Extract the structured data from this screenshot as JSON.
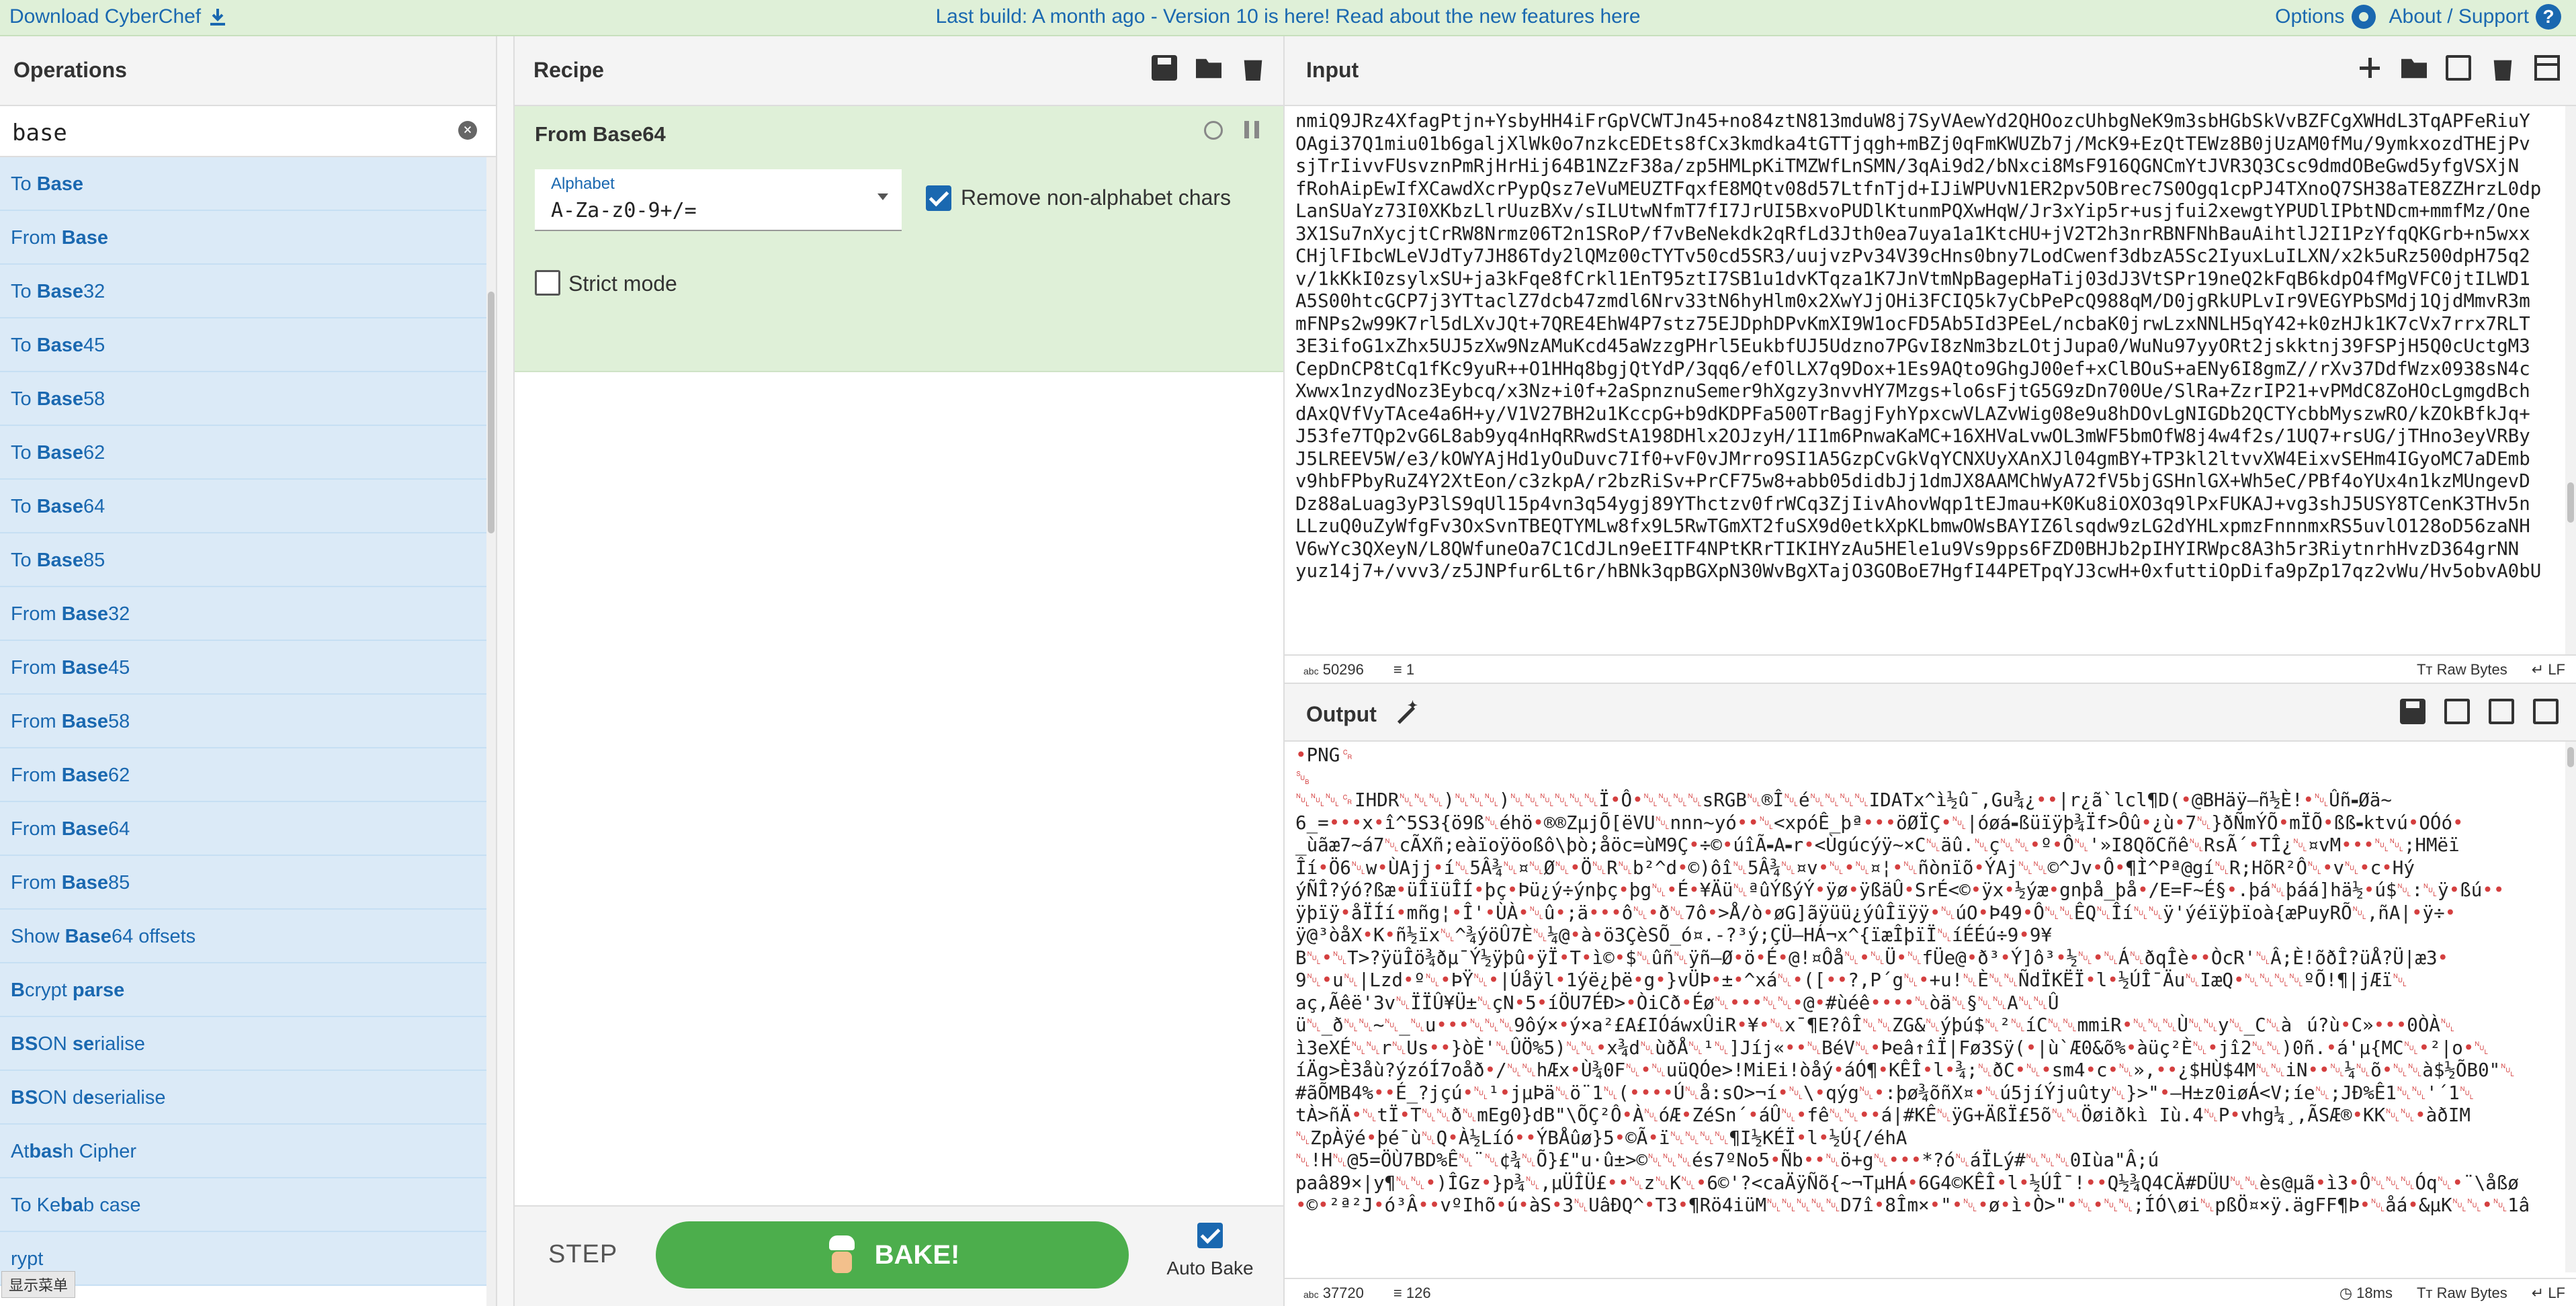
{
  "topbar": {
    "download_label": "Download CyberChef",
    "announcement": "Last build: A month ago - Version 10 is here! Read about the new features here",
    "options_label": "Options",
    "about_label": "About / Support",
    "help_glyph": "?"
  },
  "operations": {
    "title": "Operations",
    "search_value": "base",
    "items": [
      {
        "pre": "To ",
        "match": "Base",
        "post": ""
      },
      {
        "pre": "From ",
        "match": "Base",
        "post": ""
      },
      {
        "pre": "To ",
        "match": "Base",
        "post": "32"
      },
      {
        "pre": "To ",
        "match": "Base",
        "post": "45"
      },
      {
        "pre": "To ",
        "match": "Base",
        "post": "58"
      },
      {
        "pre": "To ",
        "match": "Base",
        "post": "62"
      },
      {
        "pre": "To ",
        "match": "Base",
        "post": "64"
      },
      {
        "pre": "To ",
        "match": "Base",
        "post": "85"
      },
      {
        "pre": "From ",
        "match": "Base",
        "post": "32"
      },
      {
        "pre": "From ",
        "match": "Base",
        "post": "45"
      },
      {
        "pre": "From ",
        "match": "Base",
        "post": "58"
      },
      {
        "pre": "From ",
        "match": "Base",
        "post": "62"
      },
      {
        "pre": "From ",
        "match": "Base",
        "post": "64"
      },
      {
        "pre": "From ",
        "match": "Base",
        "post": "85"
      },
      {
        "pre": "Show ",
        "match": "Base",
        "post": "64 offsets"
      },
      {
        "pre": "",
        "match": "B",
        "post": "crypt ",
        "match2": "parse"
      },
      {
        "pre": "",
        "match": "BS",
        "post": "ON ",
        "match2": "se",
        "post2": "rialise"
      },
      {
        "pre": "",
        "match": "BS",
        "post": "ON d",
        "match2": "e",
        "post2": "serialise"
      },
      {
        "pre": "At",
        "match": "bas",
        "post": "h Cipher"
      },
      {
        "pre": "To Ke",
        "match": "ba",
        "post": "b case"
      },
      {
        "pre": "",
        "match": "",
        "post": "rypt"
      }
    ],
    "overlay_badge": "显示菜单"
  },
  "recipe": {
    "title": "Recipe",
    "operation_title": "From Base64",
    "alphabet_label": "Alphabet",
    "alphabet_value": "A-Za-z0-9+/=",
    "remove_label": "Remove non-alphabet chars",
    "remove_checked": true,
    "strict_label": "Strict mode",
    "strict_checked": false,
    "step_label": "STEP",
    "bake_label": "BAKE!",
    "auto_bake_label": "Auto Bake",
    "auto_bake_checked": true
  },
  "input": {
    "title": "Input",
    "lines": [
      "nmiQ9JRz4XfagPtjn+YsbyHH4iFrGpVCWTJn45+no84ztN813mduW8j7SyVAewYd2QHOozcUhbgNeK9m3sbHGbSkVvBZFCgXWHdL3TqAPFeRiuY",
      "OAgi37Q1miu01b6galjXlWk0o7nzkcEDEts8fCx3kmdka4tGTTjqgh+mBZj0qFmKWUZb7j/McK9+EzQtTEWz8B0jUzAM0fMu/9ymkxozdTHEjPv",
      "sjTrIivvFUsvznPmRjHrHij64B1NZzF38a/zp5HMLpKiTMZWfLnSMN/3qAi9d2/bNxci8MsF916QGNCmYtJVR3Q3Csc9dmdOBeGwd5yfgVSXjN",
      "fRohAipEwIfXCawdXcrPypQsz7eVuMEUZTFqxfE8MQtv08d57LtfnTjd+IJiWPUvN1ER2pv5OBrec7S0Ogq1cpPJ4TXnoQ7SH38aTE8ZZHrzL0dp",
      "LanSUaYz73I0XKbzLlrUuzBXv/sILUtwNfmT7fI7JrUI5BxvoPUDlKtunmPQXwHqW/Jr3xYip5r+usjfui2xewgtYPUDlIPbtNDcm+mmfMz/One",
      "3X1Su7nXycjtCrRW8Nrmz06T2n1SRoP/f7vBeNekdk2qRfLd3Jth0ea7uya1a1KtcHU+jV2T2h3nrRBNFNhBauAihtlJ2I1PzYfqQKGrb+n5wxx",
      "CHjlFIbcWLeVJdTy7JH86Tdy2lQMz00cTYTv50cd5SR3/uujvzPv34V39cHns0bny7LodCwenf3dbzA5Sc2IyuxLuILXN/x2k5uRz500dpH75q2",
      "v/1kKkI0zsylxSU+ja3kFqe8fCrkl1EnT95ztI7SB1u1dvKTqza1K7JnVtmNpBagepHaTij03dJ3VtSPr19neQ2kFqB6kdpO4fMgVFC0jtILWD1",
      "A5S00htcGCP7j3YTtaclZ7dcb47zmdl6Nrv33tN6hyHlm0x2XwYJjOHi3FCIQ5k7yCbPePcQ988qM/D0jgRkUPLvIr9VEGYPbSMdj1QjdMmvR3m",
      "mFNPs2w99K7rl5dLXvJQt+7QRE4EhW4P7stz75EJDphDPvKmXI9W1ocFD5Ab5Id3PEeL/ncbaK0jrwLzxNNLH5qY42+k0zHJk1K7cVx7rrx7RLT",
      "3E3ifoG1xZhx5UJ5zXw9NzAMuKcd45aWzzgPHrl5EukbfUJ5Udzno7PGvI8zNm3bzLOtjJupa0/WuNu97yyORt2jskktnj39FSPjH5Q0cUctgM3",
      "CepDnCP8tCq1fKc9yuR++O1HHq8bgjQtYdP/3qq6/efOlLX7q9Dox+1Es9AQto9GhgJ00ef+xClBOuS+aENy6I8gmZ//rXv37DdfWzx0938sN4c",
      "Xwwx1nzydNoz3Eybcq/x3Nz+i0f+2aSpnznuSemer9hXgzy3nvvHY7Mzgs+lo6sFjtG5G9zDn700Ue/SlRa+ZzrIP21+vPMdC8ZoHOcLgmgdBch",
      "dAxQVfVyTAce4a6H+y/V1V27BH2u1KccpG+b9dKDPFa500TrBagjFyhYpxcwVLAZvWig08e9u8hDOvLgNIGDb2QCTYcbbMyszwRO/kZOkBfkJq+",
      "J53fe7TQp2vG6L8ab9yq4nHqRRwdStA198DHlx2OJzyH/1I1m6PnwaKaMC+16XHVaLvwOL3mWF5bmOfW8j4w4f2s/1UQ7+rsUG/jTHno3eyVRBy",
      "J5LREEV5W/e3/kOWYAjHd1yOuDuvc7If0+vF0vJMrro9SI1A5GzpCvGkVqYCNXUyXAnXJl04gmBY+TP3kl2ltvvXW4EixvSEHm4IGyoMC7aDEmb",
      "v9hbFPbyRuZ4Y2XtEon/c3zkpA/r2bzRiSv+PrCF75w8+abb05didbJj1dmJX8AAMChWyA72fV5bjGSHnlGX+Wh5eC/PBf4oYUx4n1kzMUngevD",
      "Dz88aLuag3yP3lS9qUl15p4vn3q54ygj89YThctzv0frWCq3ZjIivAhovWqp1tEJmau+K0Ku8iOXO3q9lPxFUKAJ+vg3shJ5USY8TCenK3THv5n",
      "LLzuQ0uZyWfgFv3OxSvnTBEQTYMLw8fx9L5RwTGmXT2fuSX9d0etkXpKLbmwOWsBAYIZ6lsqdw9zLG2dYHLxpmzFnnnmxRS5uvlO128oD56zaNH",
      "V6wYc3QXeyN/L8QWfuneOa7C1CdJLn9eEITF4NPtKRrTIKIHYzAu5HEle1u9Vs9pps6FZD0BHJb2pIHYIRWpc8A3h5r3RiytnrhHvzD364grNN",
      "yuz14j7+/vvv3/z5JNPfur6Lt6r/hBNk3qpBGXpN30WvBgXTajO3GOBoE7HgfI44PETpqYJ3cwH+0xfuttiOpDifa9pZp17qz2vWu/Hv5obvA0bU"
    ],
    "char_count": "50296",
    "line_count": "1",
    "raw_bytes_label": "Raw Bytes",
    "eol_label": "LF"
  },
  "output": {
    "title": "Output",
    "lines": [
      "•PNG␍",
      "␚",
      "␀␀␀␍IHDR␀␀␀)␀␀␀)␀␀␀␀␀␀Ï•Ô•␀␀␀␀sRGB␀®Î␀é␀␀␀␀IDATx^ì½û¯,Gu¾¿••|r¿ã`lcl¶D(•@BHäÿ–ñ½È!•␀Ûñ⁃Øä~",
      "6_=•••x•î^5S3{ö9ß␀éhö•®®ZµjÕ[ëVU␀nnn~yó••␀<xpóÊ_þª•••öØÏÇ•␀|óøá⁃ßüïÿþ¾Ïf>Ôû•¿ù•7␀}ðÑmÝÕ•mÏÕ•ßß⁃ktvú•OÓó•",
      "_ùãæ7~á7␀cÃXñ;eàïoÿöoßô\\þò;åöc=ùM9Ç•÷©•úîÃ⁃A⁃r•<Ùgúcýÿ~×C␀äû.␀ç␀␀•º•Ô␀'»I8QõCñê␀RsÃ´•TÎ¿␀¤vM•••␀␀;HMëï",
      "Îí•Ö6␀w•ÙAjj•í␀5Â¾␀¤␀Ø␀•Ö␀R␀b²^d•©)ôî␀5Â¾␀¤v•␀•␀¤¦•␀ñònïõ•ÝAj␀␀©^Jv•Ô•¶Ì^Pª@gí␀R;HõR²Ô␀•v␀•c•Hý",
      "ýÑÎ?ýó?ßæ•üÎïüÎÍ•þç•Þü¿ý÷ýnþç•þg␀•É•¥Äü␀ªûÝßýÝ•ÿø•ÿßäÛ•SrÉ<©•ÿx•½ýæ•gnþå_þå•/E=F~É§•.þá␀þáá]hä½•ú$␀:␀ÿ•ßú••",
      "ÿþïÿ•åÏÍí•mñg¦•Î'•ÙÀ•␀û•;ä•••ô␀•ð␀7ô•>Å/ò•øG]ãÿüü¿ýûÎïÿÿ•␀úO•Þ49•Ô␀␀ÊQ␀Îí␀␀ÿ'ýéïÿþïoà{æPuyRÕ␀,ñA|•ÿ÷•",
      "ÿ@³òåX•K•ñ½ïx␀^¾ýöÛ7È␀¼@•à•ö3ÇèSÕ_ó¤.-?³ý;ÇÜ–HÁ¬x^{ïæÎþïÏ␀íÉÉú÷9•9¥",
      "B␀•␀T>?ÿüÎö¾ðµ¯Ý½ÿþû•ÿÏ•T•ì©•$␀ûñ␀ÿñ–Ø•ö•É•@!¤Ôå␀•␀Ü•␀fÜe@•ð³•Ý]ô³•½␀•␀Á␀ðqÎè••ÒcR'␀Â;È!õðÎ?üÅ?Ü|æ3•",
      "9␀•u␀|Lzd•º␀•ÞŸ␀•|Úåÿl•1ýë¿þë•g•}vÜÞ•±•^xá␀•([••?,P´g␀•+u!␀È␀␀ÑdÏKËÏ•l•½ÚÎ¯Äu␀IæQ•␀␀␀␀ºÕ!¶|jÆï␀",
      "aç,Ãêë'3v␀ÏÏÛ¥Ü±␀çN•5•íÖU7ÉÐ>•ÒiCð•Éø␀•••␀␀•@•#ùéê••••␀òä␀§␀␀A␀␀Û",
      "ü␀_ð␀␀~␀_␀u•••␀␀␀9ôý×•ý×a²£A£IÓáwxÛiR•¥•␀x¯¶E?ôÎ␀␀ZG&␀ýþú$␀²␀íC␀␀mmiR•␀␀␀Ù␀␀y␀_C␀àú?ù•C»•••0ÒÀ␀",
      "ì3eXÉ␀␀r␀Us••}òÈ'␀ÛÖ%5)␀␀•x¾d␀ùðÅ␀¹␀]Jíj«••␀BéV␀•Þeâ↑îÏ|Fø3Sÿ(•|ù`Æ0&õ%•àüç²È␀•jî2␀␀)0ñ.•á'µ{MC␀•²|o•␀",
      "íÄg>È3åù?ýzóÍ7oåð•/␀␀hÆx•Ù¾0F␀•␀uüQÓe>!MiEi!òåý•áÓ¶•KÊÎ•l•¾;␀ðC•␀•sm4•c•␀»,••¿$HÙ$4M␀␀iN••␀¼␀õ•␀␀à$½ÕB0\"␀",
      "#ãÕMB4%••É_?jçú•␀¹•jµÞä␀ö¨1␀(••••Ú␀å:sO>¬í•␀\\•qýg␀•:þø¾õñX¤•␀ú5jíÝjuûty␀}>\"•–H±z0iøÁ<V;íe␀;JÐ%Ê1␀␀'´1␀",
      "tÀ>ñÄ•␀tÏ•T␀␀ð␀mEg0}dB\"\\ÕÇ²Ô•À␀óÆ•ZéSn´•áÛ␀•fê␀␀••á|#KÊ␀ÿG+ÄßÏ£5õ␀␀Öøiðkì Iù.4␀P•vhg¼¸,ÃSÆ®•KK␀␀•àðIM",
      "␀ZpÀÿé•þé¯ù␀Q•À½Líó••ÝBÅûø}5•©Ã•ï␀␀␀␀¶I½KÉÏ•l•½Ú{/éhA",
      "␀!H␀@5=ÖÙ7BD%Ê␀¨␀¢¾␀Õ}£\"u·û±>©␀␀␀és7ºNo5•Ñb••␀ö+g␀•••*?ó␀áÏLý#␀␀␀0Iùa\"Â;ú",
      "paâ89×|y¶␀␀•)ÎGz•}p¾␀,µÜÎÜ£••␀z␀K␀•6©'?<caÄÿÑõ{~¬TµHÁ•6G4©KÊÎ•l•½ÚÎ¯!••Q½¾Q4CÄ#DÜU␀␀ès@µã•ì3•Ô␀␀␀Óq␀•¨\\åßø",
      "•©•²ª²J•ó³Â••vºIhõ•ú•àS•3␀UâÐQ^•T3•¶Rö4iüM␀␀␀␀␀D7î•8Îm×•\"•␀•ø•ì•Ò>\"•␀•␀␀;ÍÓ\\øi␀pßÖ¤×ÿ.ägFF¶Þ•␀åá•&µK␀␀•␀1â"
    ],
    "char_count": "37720",
    "line_count": "126",
    "time_label": "18ms",
    "raw_bytes_label": "Raw Bytes",
    "eol_label": "LF"
  }
}
